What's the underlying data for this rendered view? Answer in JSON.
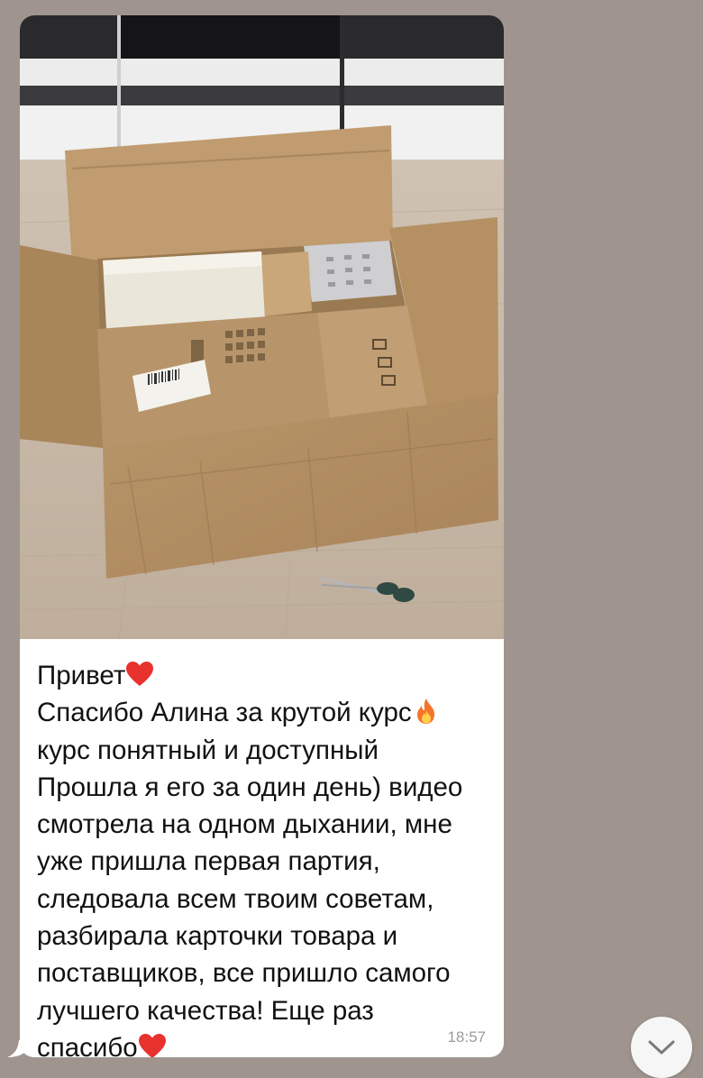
{
  "message": {
    "greeting": "Привет",
    "line2": "Спасибо Алина за крутой курс",
    "body": "курс понятный и доступный\nПрошла я его за один день) видео\nсмотрела на одном дыхании, мне\nуже пришла первая партия,\nследовала всем твоим советам,\nразбирала карточки товара и\nпоставщиков, все пришло самого\nлучшего качества! Еще раз",
    "closing": "спасибо",
    "time": "18:57",
    "emojis": [
      "red-heart",
      "fire",
      "red-heart"
    ]
  },
  "photo": {
    "subject": "open-cardboard-box-with-packages"
  },
  "colors": {
    "chat_background": "#9f958e",
    "bubble": "#ffffff",
    "text": "#111111",
    "timestamp": "#9b9b9b"
  }
}
